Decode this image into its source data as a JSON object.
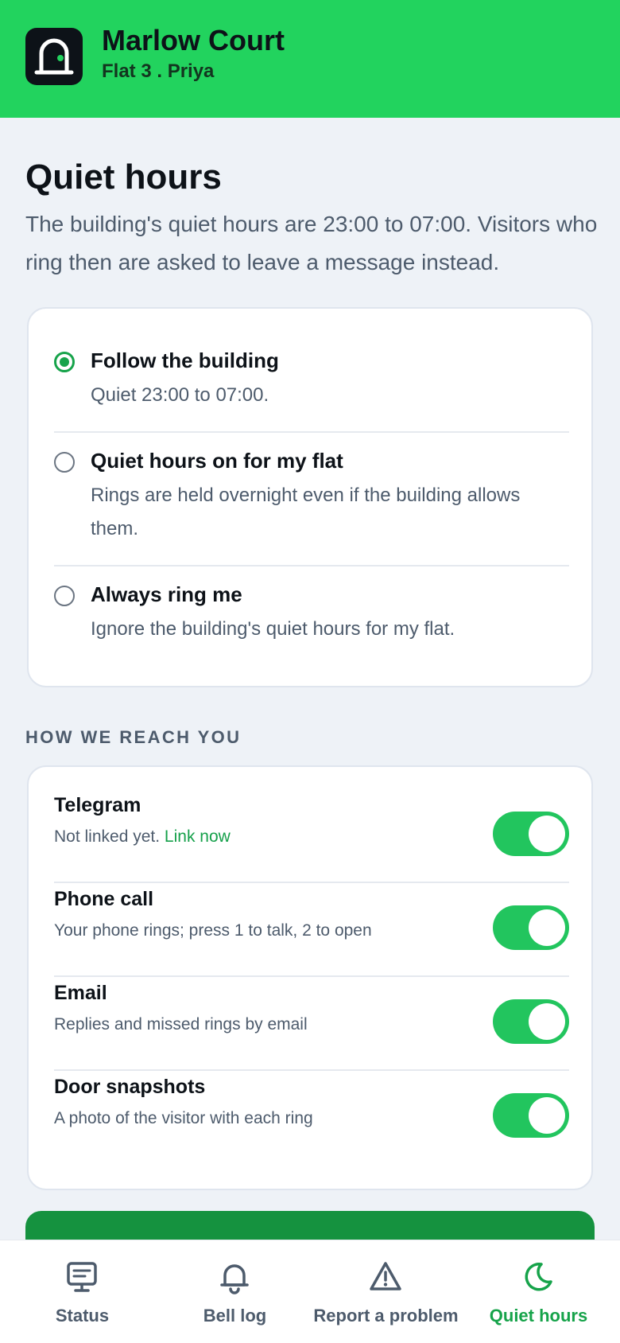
{
  "header": {
    "title": "Marlow Court",
    "subtitle": "Flat 3 . Priya",
    "logo_icon": "doorway-icon"
  },
  "page": {
    "title": "Quiet hours",
    "description": "The building's quiet hours are 23:00 to 07:00. Visitors who ring then are asked to leave a message instead."
  },
  "quiet_options": [
    {
      "label": "Follow the building",
      "description": "Quiet 23:00 to 07:00.",
      "selected": true
    },
    {
      "label": "Quiet hours on for my flat",
      "description": "Rings are held overnight even if the building allows them.",
      "selected": false
    },
    {
      "label": "Always ring me",
      "description": "Ignore the building's quiet hours for my flat.",
      "selected": false
    }
  ],
  "reach": {
    "section_label": "HOW WE REACH YOU",
    "channels": [
      {
        "label": "Telegram",
        "description": "Not linked yet.",
        "link_text": "Link now",
        "enabled": true
      },
      {
        "label": "Phone call",
        "description": "Your phone rings; press 1 to talk, 2 to open",
        "enabled": true
      },
      {
        "label": "Email",
        "description": "Replies and missed rings by email",
        "enabled": true
      },
      {
        "label": "Door snapshots",
        "description": "A photo of the visitor with each ring",
        "enabled": true
      }
    ]
  },
  "tabs": [
    {
      "label": "Status",
      "icon": "monitor-icon",
      "active": false
    },
    {
      "label": "Bell log",
      "icon": "bell-icon",
      "active": false
    },
    {
      "label": "Report a problem",
      "icon": "warning-icon",
      "active": false
    },
    {
      "label": "Quiet hours",
      "icon": "moon-icon",
      "active": true
    }
  ],
  "colors": {
    "brand": "#22d35e",
    "accent": "#16a34a",
    "primary_button": "#15923f",
    "text_dark": "#0d1218",
    "text_muted": "#4d5b6c"
  }
}
